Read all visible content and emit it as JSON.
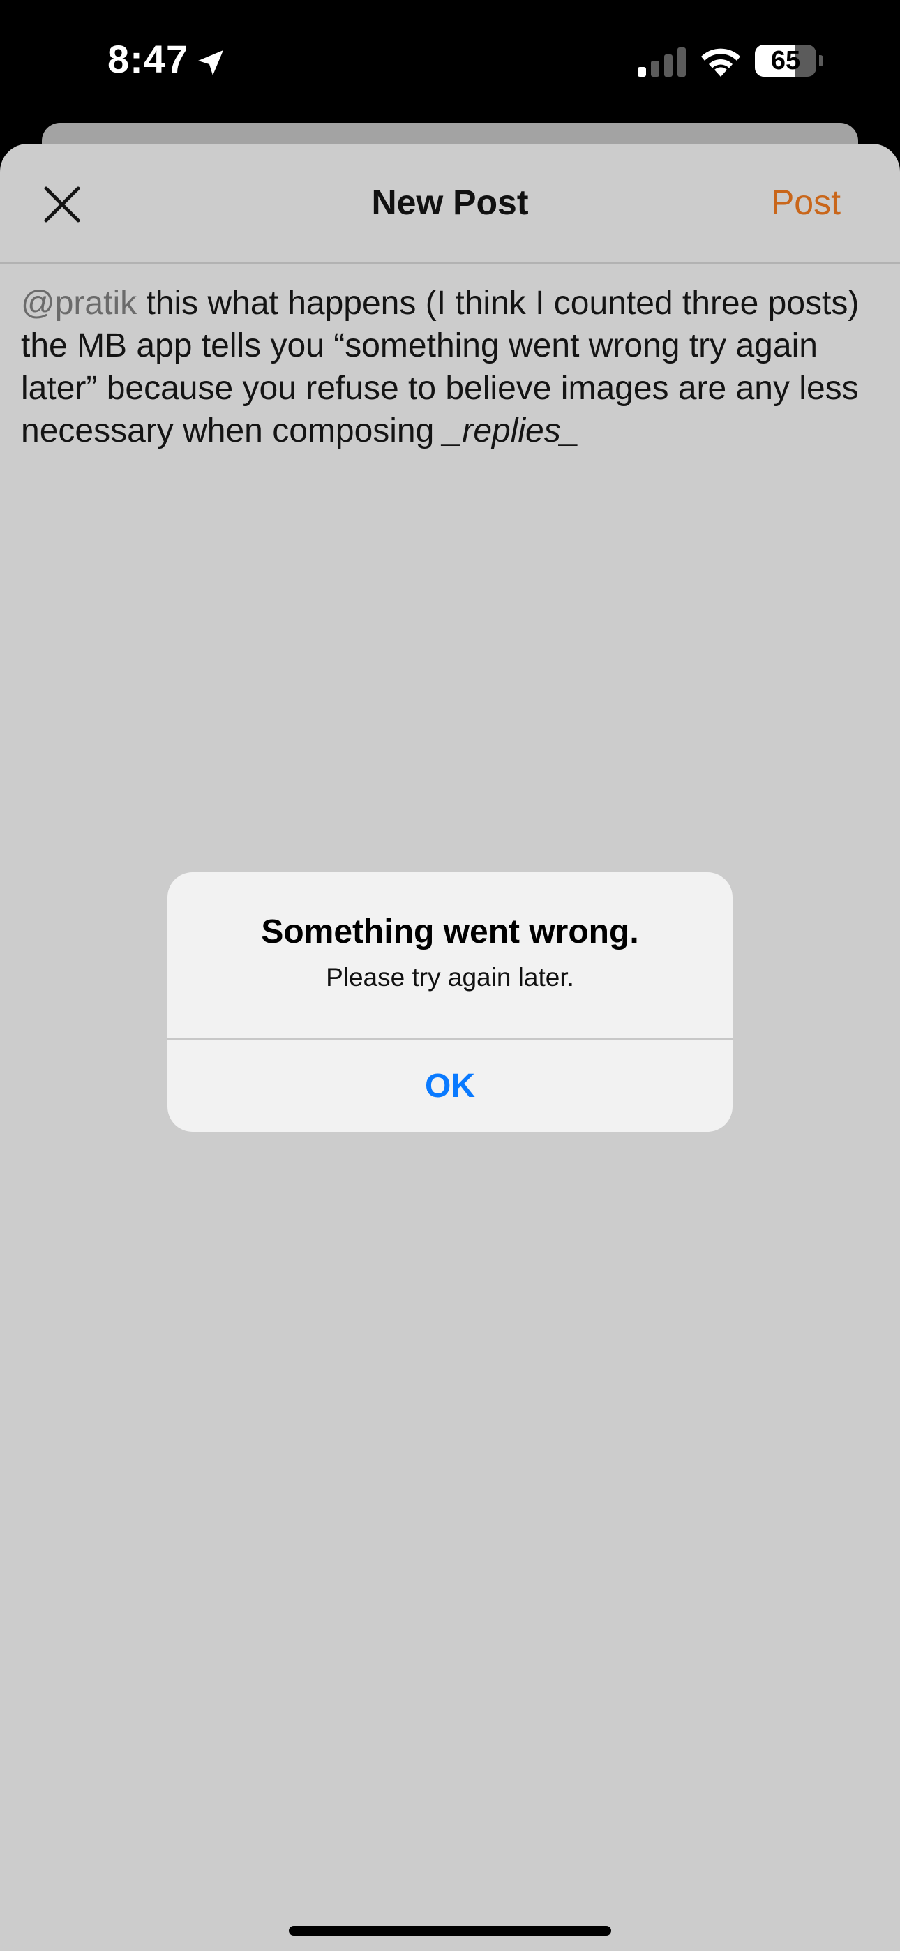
{
  "status_bar": {
    "time": "8:47",
    "battery_level": "65",
    "battery_fraction": 0.65,
    "icons": [
      "location-arrow-icon",
      "cellular-signal-icon",
      "wifi-icon",
      "battery-icon"
    ]
  },
  "nav": {
    "title": "New Post",
    "post_label": "Post",
    "close_icon": "close-icon"
  },
  "compose": {
    "mention": "@pratik",
    "text": " this what happens (I think I counted three posts) the MB app tells you “something went wrong try again later” because you refuse to believe images are any less necessary when composing ",
    "emphasis": "_replies_"
  },
  "alert": {
    "title": "Something went wrong.",
    "message": "Please try again later.",
    "ok_label": "OK"
  },
  "colors": {
    "accent": "#c9661a",
    "alert_button": "#0a7aff",
    "dimmed_background": "#cccccc"
  }
}
